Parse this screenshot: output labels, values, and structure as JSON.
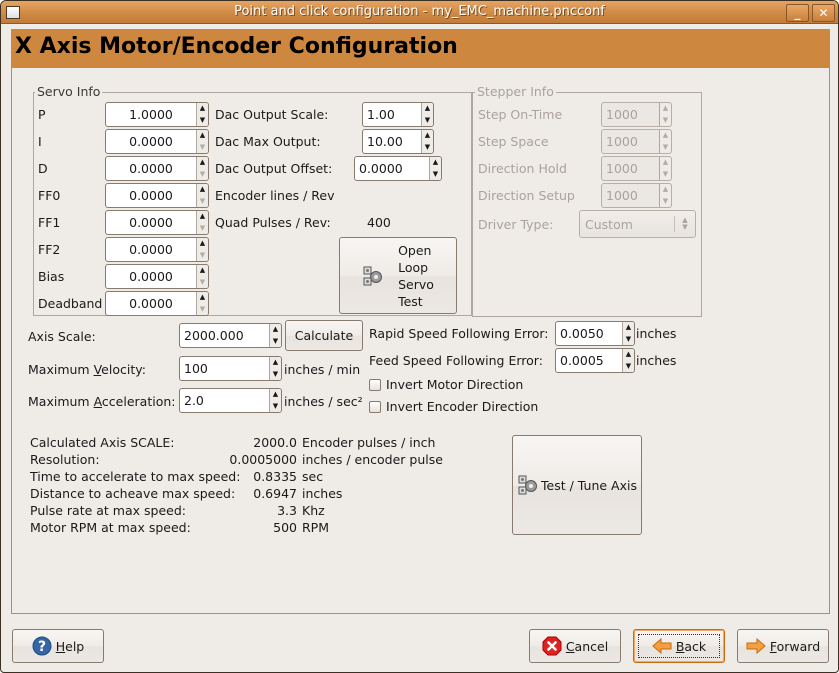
{
  "window": {
    "title": "Point and click configuration - my_EMC_machine.pncconf",
    "minimize_label": "_",
    "close_label": "✕"
  },
  "header": {
    "title": "X Axis Motor/Encoder Configuration"
  },
  "colors": {
    "accent": "#cd873e",
    "background": "#efebe7",
    "focus": "#cd6a14"
  },
  "servo_info": {
    "title": "Servo Info",
    "fields": [
      {
        "label": "P",
        "value": "1.0000"
      },
      {
        "label": "I",
        "value": "0.0000"
      },
      {
        "label": "D",
        "value": "0.0000"
      },
      {
        "label": "FF0",
        "value": "0.0000"
      },
      {
        "label": "FF1",
        "value": "0.0000"
      },
      {
        "label": "FF2",
        "value": "0.0000"
      },
      {
        "label": "Bias",
        "value": "0.0000"
      },
      {
        "label": "Deadband",
        "value": "0.0000"
      }
    ],
    "dac_output_scale": {
      "label": "Dac Output Scale:",
      "value": "1.00"
    },
    "dac_max_output": {
      "label": "Dac Max Output:",
      "value": "10.00"
    },
    "dac_output_offset": {
      "label": "Dac Output Offset:",
      "value": "0.0000"
    },
    "encoder_lines": {
      "label": "Encoder lines / Rev"
    },
    "quad_pulses": {
      "label": "Quad Pulses / Rev:",
      "value": "400"
    },
    "open_loop_button": {
      "line1": "Open",
      "line2": "Loop",
      "line3": "Servo",
      "line4": "Test",
      "icon": "gears-icon"
    }
  },
  "stepper_info": {
    "title": "Stepper Info",
    "fields": [
      {
        "label": "Step On-Time",
        "value": "1000"
      },
      {
        "label": "Step Space",
        "value": "1000"
      },
      {
        "label": "Direction Hold",
        "value": "1000"
      },
      {
        "label": "Direction Setup",
        "value": "1000"
      }
    ],
    "driver_type": {
      "label": "Driver Type:",
      "value": "Custom"
    }
  },
  "axis": {
    "axis_scale": {
      "label": "Axis Scale:",
      "value": "2000.000"
    },
    "calculate_label": "Calculate",
    "max_velocity": {
      "label_pre": "Maximum ",
      "label_mnemonic": "V",
      "label_post": "elocity:",
      "value": "100",
      "unit": "inches / min"
    },
    "max_acceleration": {
      "label_pre": "Maximum ",
      "label_mnemonic": "A",
      "label_post": "cceleration:",
      "value": "2.0",
      "unit": "inches / sec²"
    },
    "rapid_ferror": {
      "label": "Rapid Speed Following Error:",
      "value": "0.0050",
      "unit": "inches"
    },
    "feed_ferror": {
      "label": "Feed Speed Following Error:",
      "value": "0.0005",
      "unit": "inches"
    },
    "invert_motor": {
      "label": "Invert Motor Direction",
      "checked": false
    },
    "invert_encoder": {
      "label": "Invert Encoder Direction",
      "checked": false
    }
  },
  "calculated": [
    {
      "label": "Calculated Axis SCALE:",
      "value": "2000.0",
      "unit": "Encoder pulses / inch"
    },
    {
      "label": "Resolution:",
      "value": "0.0005000",
      "unit": "inches / encoder pulse"
    },
    {
      "label": "Time to accelerate to max speed:",
      "value": "0.8335",
      "unit": "sec"
    },
    {
      "label": "Distance to acheave max speed:",
      "value": "0.6947",
      "unit": "inches"
    },
    {
      "label": "Pulse rate at max speed:",
      "value": "3.3",
      "unit": "Khz"
    },
    {
      "label": "Motor RPM at max speed:",
      "value": "500",
      "unit": "RPM"
    }
  ],
  "test_tune_button": {
    "label": "Test / Tune Axis",
    "icon": "gears-icon"
  },
  "footer": {
    "help": {
      "mnemonic": "H",
      "rest": "elp",
      "icon": "help-icon"
    },
    "cancel": {
      "mnemonic": "C",
      "rest": "ancel",
      "icon": "cancel-icon"
    },
    "back": {
      "mnemonic": "B",
      "rest": "ack",
      "icon": "back-arrow-icon"
    },
    "forward": {
      "mnemonic": "F",
      "rest": "orward",
      "icon": "forward-arrow-icon"
    }
  }
}
